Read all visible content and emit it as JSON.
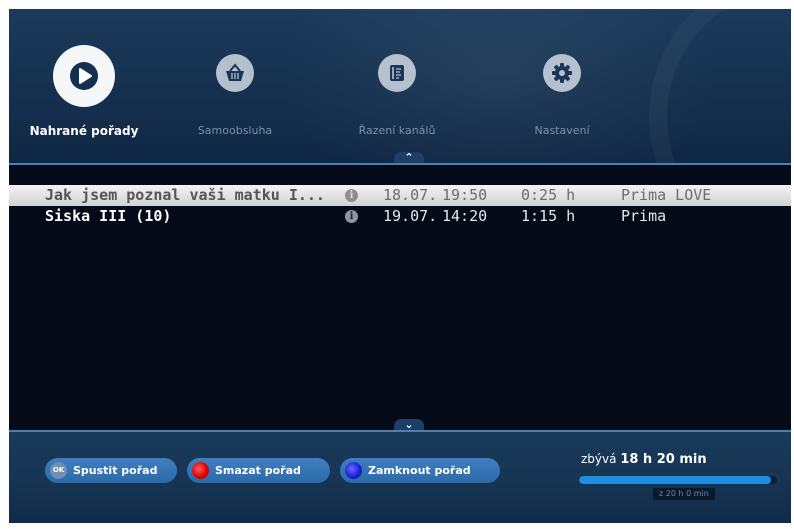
{
  "menu": {
    "items": [
      {
        "label": "Nahrané pořady",
        "icon": "play-icon",
        "active": true
      },
      {
        "label": "Samoobsluha",
        "icon": "basket-icon",
        "active": false
      },
      {
        "label": "Řazení kanálů",
        "icon": "sort-list-icon",
        "active": false
      },
      {
        "label": "Nastavení",
        "icon": "gear-icon",
        "active": false
      }
    ]
  },
  "list": {
    "scroll_up_glyph": "⌃",
    "scroll_down_glyph": "⌄",
    "info_glyph": "i",
    "rows": [
      {
        "title": "Jak jsem poznal vaši matku I...",
        "date": "18.07.",
        "time": "19:50",
        "duration": "0:25 h",
        "channel": "Prima LOVE",
        "selected": true
      },
      {
        "title": "Siska III (10)",
        "date": "19.07.",
        "time": "14:20",
        "duration": "1:15 h",
        "channel": "Prima",
        "selected": false
      }
    ]
  },
  "footer": {
    "buttons": {
      "play": {
        "key": "OK",
        "label": "Spustit pořad"
      },
      "delete": {
        "key": "red",
        "label": "Smazat pořad"
      },
      "lock": {
        "key": "blue",
        "label": "Zamknout pořad"
      }
    },
    "remaining_prefix": "zbývá",
    "remaining_value": "18 h 20 min",
    "total_label": "z 20 h 0 min",
    "storage_remaining_fraction": 0.97
  },
  "colors": {
    "accent": "#2c6aa9",
    "selected_row": "#e6e6e6",
    "background": "#040a18",
    "progress": "#1e8fe0"
  }
}
